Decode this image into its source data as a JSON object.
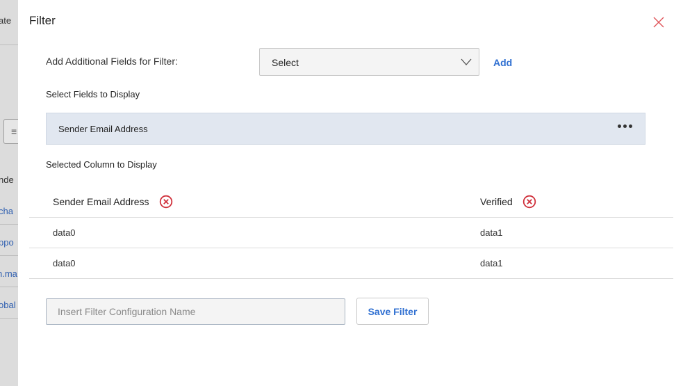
{
  "background": {
    "texts": [
      "ate",
      "nde",
      "cha",
      "ppo",
      "n.ma",
      "obal"
    ],
    "button_icon": "list-filter-icon"
  },
  "modal": {
    "title": "Filter",
    "close_icon": "close-icon",
    "additional_fields": {
      "label": "Add Additional Fields for Filter:",
      "select_value": "Select",
      "add_label": "Add"
    },
    "select_fields_label": "Select Fields to Display",
    "available_fields": [
      {
        "name": "Sender Email Address",
        "menu_icon": "more-horizontal-icon"
      }
    ],
    "selected_columns_label": "Selected Column to Display",
    "table": {
      "columns": [
        {
          "label": "Sender Email Address",
          "remove_icon": "remove-circle-icon"
        },
        {
          "label": "Verified",
          "remove_icon": "remove-circle-icon"
        }
      ],
      "rows": [
        [
          "data0",
          "data1"
        ],
        [
          "data0",
          "data1"
        ]
      ]
    },
    "config_name": {
      "placeholder": "Insert Filter Configuration Name",
      "value": ""
    },
    "save_label": "Save Filter"
  },
  "colors": {
    "accent": "#2f6fd1",
    "remove": "#d0313c",
    "close": "#e0555b",
    "chip_bg": "#e1e7f0"
  }
}
